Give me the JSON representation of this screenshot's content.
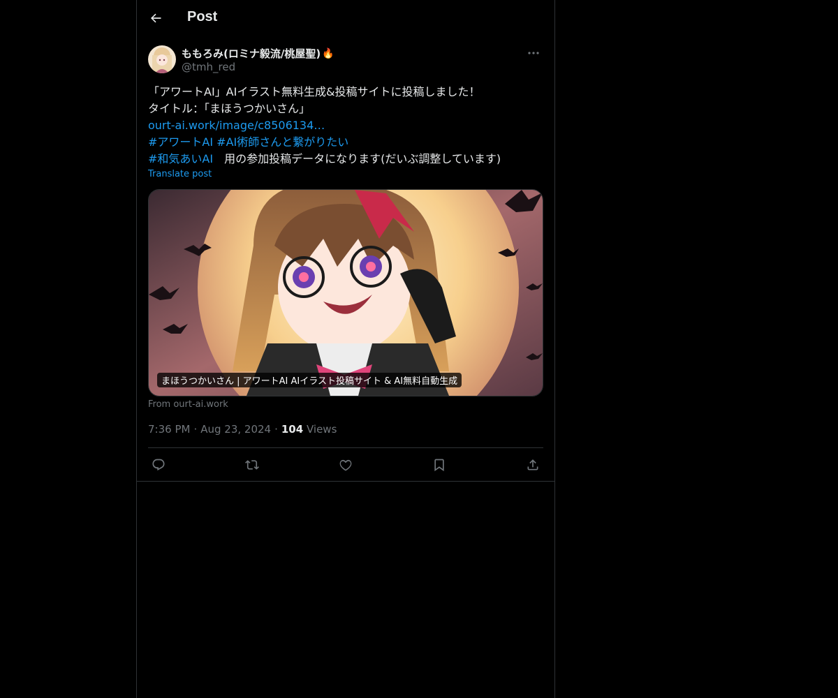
{
  "header": {
    "title": "Post",
    "back_icon": "arrow-left-icon"
  },
  "post": {
    "author": {
      "display_name": "ももろみ(ロミナ毅流/桃屋聖)",
      "emoji": "🔥",
      "handle": "@tmh_red"
    },
    "text": {
      "line1": "「アワートAI」AIイラスト無料生成&投稿サイトに投稿しました！",
      "line2": "タイトル：「まほうつかいさん」",
      "link": "ourt-ai.work/image/c8506134…",
      "hashtag1": "#アワートAI",
      "hashtag2": "#AI術師さんと繋がりたい",
      "hashtag3": "#和気あいAI",
      "line_tail": "　用の参加投稿データになります(だいぶ調整しています)"
    },
    "translate_label": "Translate post",
    "card": {
      "caption": "まほうつかいさん | アワートAI AIイラスト投稿サイト & AI無料自動生成",
      "source": "From ourt-ai.work"
    },
    "meta": {
      "time": "7:36 PM",
      "date": "Aug 23, 2024",
      "separator": "·",
      "views_count": "104",
      "views_label": "Views"
    },
    "actions": [
      "reply-icon",
      "repost-icon",
      "like-icon",
      "bookmark-icon",
      "share-icon"
    ]
  },
  "colors": {
    "background": "#000000",
    "text": "#e7e9ea",
    "secondary": "#71767b",
    "link": "#1d9bf0",
    "border": "#2f3336"
  }
}
